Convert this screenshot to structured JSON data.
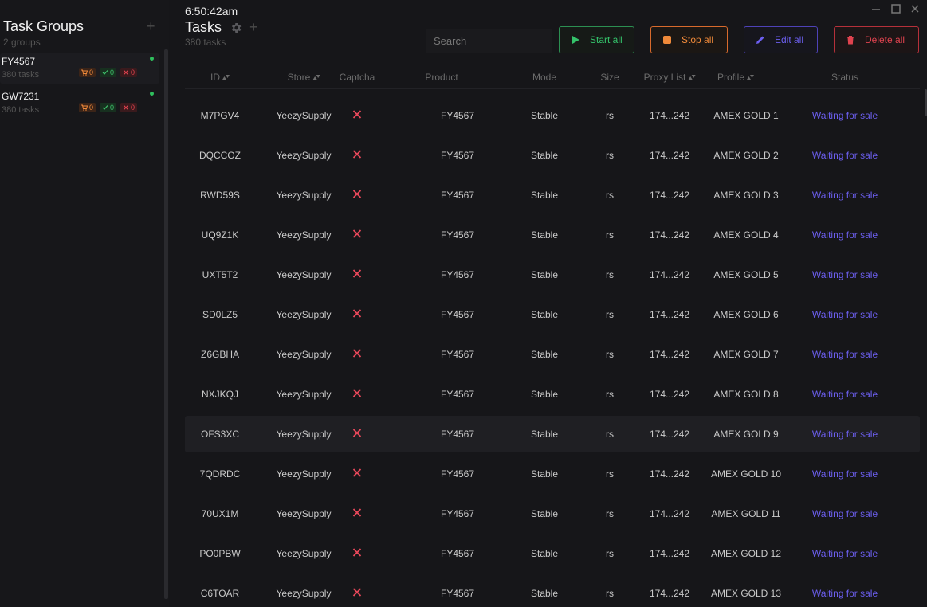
{
  "sidebar": {
    "title": "Task Groups",
    "subtitle": "2 groups",
    "add_glyph": "+",
    "groups": [
      {
        "name": "FY4567",
        "tasks_label": "380 tasks",
        "carted": "0",
        "success": "0",
        "failed": "0",
        "active": true
      },
      {
        "name": "GW7231",
        "tasks_label": "380 tasks",
        "carted": "0",
        "success": "0",
        "failed": "0",
        "active": false
      }
    ]
  },
  "main": {
    "clock": "6:50:42am",
    "title": "Tasks",
    "subtitle": "380 tasks",
    "add_glyph": "+",
    "search": {
      "placeholder": "Search",
      "value": ""
    },
    "buttons": {
      "start": "Start all",
      "stop": "Stop all",
      "edit": "Edit all",
      "delete": "Delete all"
    },
    "columns": {
      "id": "ID",
      "store": "Store",
      "captcha": "Captcha",
      "product": "Product",
      "mode": "Mode",
      "size": "Size",
      "proxy": "Proxy List",
      "profile": "Profile",
      "status": "Status"
    },
    "rows": [
      {
        "id": "M7PGV4",
        "store": "YeezySupply",
        "product": "FY4567",
        "mode": "Stable",
        "size": "rs",
        "proxy": "174...242",
        "profile": "AMEX GOLD 1",
        "status": "Waiting for sale"
      },
      {
        "id": "DQCCOZ",
        "store": "YeezySupply",
        "product": "FY4567",
        "mode": "Stable",
        "size": "rs",
        "proxy": "174...242",
        "profile": "AMEX GOLD 2",
        "status": "Waiting for sale"
      },
      {
        "id": "RWD59S",
        "store": "YeezySupply",
        "product": "FY4567",
        "mode": "Stable",
        "size": "rs",
        "proxy": "174...242",
        "profile": "AMEX GOLD 3",
        "status": "Waiting for sale"
      },
      {
        "id": "UQ9Z1K",
        "store": "YeezySupply",
        "product": "FY4567",
        "mode": "Stable",
        "size": "rs",
        "proxy": "174...242",
        "profile": "AMEX GOLD 4",
        "status": "Waiting for sale"
      },
      {
        "id": "UXT5T2",
        "store": "YeezySupply",
        "product": "FY4567",
        "mode": "Stable",
        "size": "rs",
        "proxy": "174...242",
        "profile": "AMEX GOLD 5",
        "status": "Waiting for sale"
      },
      {
        "id": "SD0LZ5",
        "store": "YeezySupply",
        "product": "FY4567",
        "mode": "Stable",
        "size": "rs",
        "proxy": "174...242",
        "profile": "AMEX GOLD 6",
        "status": "Waiting for sale"
      },
      {
        "id": "Z6GBHA",
        "store": "YeezySupply",
        "product": "FY4567",
        "mode": "Stable",
        "size": "rs",
        "proxy": "174...242",
        "profile": "AMEX GOLD 7",
        "status": "Waiting for sale"
      },
      {
        "id": "NXJKQJ",
        "store": "YeezySupply",
        "product": "FY4567",
        "mode": "Stable",
        "size": "rs",
        "proxy": "174...242",
        "profile": "AMEX GOLD 8",
        "status": "Waiting for sale"
      },
      {
        "id": "OFS3XC",
        "store": "YeezySupply",
        "product": "FY4567",
        "mode": "Stable",
        "size": "rs",
        "proxy": "174...242",
        "profile": "AMEX GOLD 9",
        "status": "Waiting for sale",
        "highlighted": true
      },
      {
        "id": "7QDRDC",
        "store": "YeezySupply",
        "product": "FY4567",
        "mode": "Stable",
        "size": "rs",
        "proxy": "174...242",
        "profile": "AMEX GOLD 10",
        "status": "Waiting for sale"
      },
      {
        "id": "70UX1M",
        "store": "YeezySupply",
        "product": "FY4567",
        "mode": "Stable",
        "size": "rs",
        "proxy": "174...242",
        "profile": "AMEX GOLD 11",
        "status": "Waiting for sale"
      },
      {
        "id": "PO0PBW",
        "store": "YeezySupply",
        "product": "FY4567",
        "mode": "Stable",
        "size": "rs",
        "proxy": "174...242",
        "profile": "AMEX GOLD 12",
        "status": "Waiting for sale"
      },
      {
        "id": "C6TOAR",
        "store": "YeezySupply",
        "product": "FY4567",
        "mode": "Stable",
        "size": "rs",
        "proxy": "174...242",
        "profile": "AMEX GOLD 13",
        "status": "Waiting for sale"
      }
    ]
  },
  "icons": {
    "captcha_unsolved": "x-icon",
    "settings": "gear-icon",
    "sort": "sort-arrows-icon",
    "start": "play-icon",
    "stop": "stop-icon",
    "edit": "pencil-icon",
    "delete": "trash-icon"
  },
  "colors": {
    "background": "#161619",
    "start": "#34c26a",
    "stop": "#f08a3a",
    "edit": "#6c5ff0",
    "delete": "#e0434f",
    "status": "#6c5ff0",
    "online_dot": "#2fbf5d"
  }
}
